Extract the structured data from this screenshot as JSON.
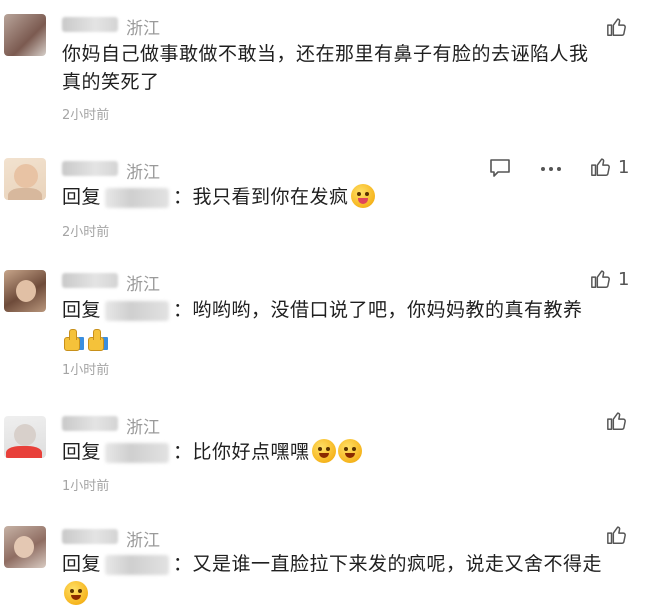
{
  "comments": [
    {
      "location": "浙江",
      "text_line1": "你妈自己做事敢做不敢当，还在那里有鼻子有脸的去诬陷人我",
      "text_line2": "真的笑死了",
      "time": "2小时前",
      "likes": ""
    },
    {
      "location": "浙江",
      "reply_label": "回复",
      "text": "：我只看到你在发疯",
      "time": "2小时前",
      "likes": "1"
    },
    {
      "location": "浙江",
      "reply_label": "回复",
      "text": "：哟哟哟，没借口说了吧，你妈妈教的真有教养",
      "time": "1小时前",
      "likes": "1"
    },
    {
      "location": "浙江",
      "reply_label": "回复",
      "text": "：比你好点嘿嘿",
      "time": "1小时前",
      "likes": ""
    },
    {
      "location": "浙江",
      "reply_label": "回复",
      "text": "：又是谁一直脸拉下来发的疯呢，说走又舍不得走",
      "time": "",
      "likes": ""
    }
  ],
  "icons": {
    "like": "thumbs-up-icon",
    "reply": "comment-icon",
    "more": "more-icon"
  }
}
